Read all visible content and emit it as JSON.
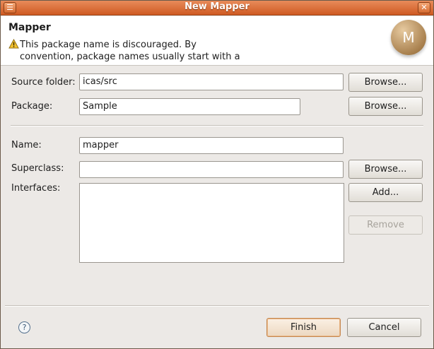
{
  "window": {
    "title": "New Mapper"
  },
  "header": {
    "title": "Mapper",
    "message_line1": "This package name is discouraged. By",
    "message_line2": "convention, package names usually start with a",
    "logo_letter": "M"
  },
  "form": {
    "source_folder_label": "Source folder:",
    "source_folder_value": "icas/src",
    "package_label": "Package:",
    "package_value": "Sample",
    "name_label": "Name:",
    "name_value": "mapper",
    "superclass_label": "Superclass:",
    "superclass_value": "",
    "interfaces_label": "Interfaces:"
  },
  "buttons": {
    "browse_source": "Browse...",
    "browse_package": "Browse...",
    "browse_superclass": "Browse...",
    "add": "Add...",
    "remove": "Remove",
    "finish": "Finish",
    "cancel": "Cancel"
  },
  "icons": {
    "help": "?",
    "titlebar_left": "window-menu-icon",
    "titlebar_right": "close-icon"
  },
  "colors": {
    "titlebar": "#d8642b",
    "dialog_bg": "#ece9e6",
    "header_bg": "#ffffff"
  }
}
